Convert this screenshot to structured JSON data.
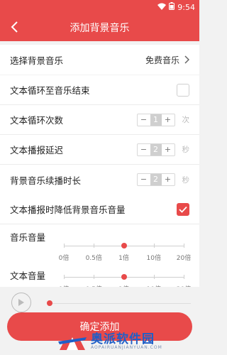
{
  "status_bar": {
    "time": "9:54"
  },
  "header": {
    "title": "添加背景音乐"
  },
  "music_select": {
    "label": "选择背景音乐",
    "value": "免费音乐"
  },
  "settings": {
    "loop_until_end": {
      "label": "文本循环至音乐结束",
      "checked": false
    },
    "loop_count": {
      "label": "文本循环次数",
      "value": "1",
      "unit": "次"
    },
    "broadcast_delay": {
      "label": "文本播报延迟",
      "value": "2",
      "unit": "秒"
    },
    "bgm_extend": {
      "label": "背景音乐续播时长",
      "value": "2",
      "unit": "秒"
    }
  },
  "volume": {
    "lower_bgm": {
      "label": "文本播报时降低背景音乐音量",
      "checked": true
    },
    "music_volume": {
      "label": "音乐音量",
      "level": "1倍"
    },
    "text_volume": {
      "label": "文本音量",
      "level": "1倍"
    },
    "scale_labels": [
      "0倍",
      "0.5倍",
      "1倍",
      "10倍",
      "20倍"
    ]
  },
  "confirm_label": "确定添加",
  "watermark": {
    "text": "奥派软件园",
    "sub": "AOPAIRUANJIANYUAN.COM"
  },
  "colors": {
    "accent": "#e84a4a",
    "background": "#f2f2f2"
  }
}
